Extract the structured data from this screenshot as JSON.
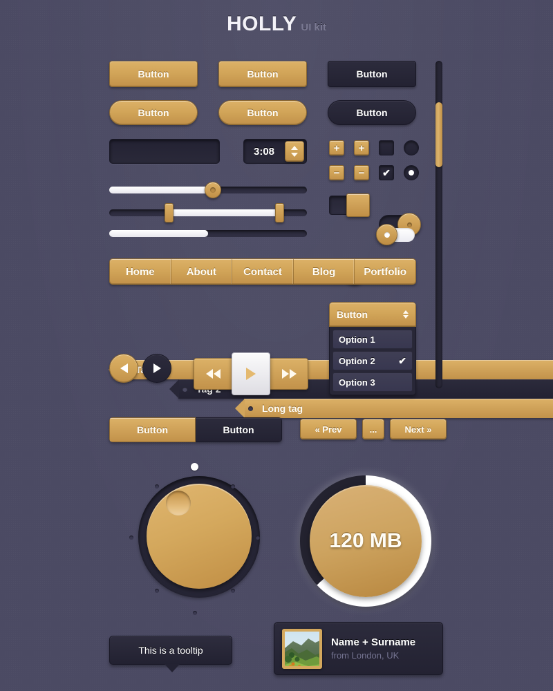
{
  "title": {
    "logo": "HOLLY",
    "subtitle": "UI kit"
  },
  "buttons": {
    "rect_gold_1": "Button",
    "rect_gold_2": "Button",
    "rect_dark": "Button",
    "pill_gold_1": "Button",
    "pill_gold_2": "Button",
    "pill_dark": "Button"
  },
  "search": {
    "value": "",
    "placeholder": "",
    "icon": "search-icon"
  },
  "stepper": {
    "value": "3:08",
    "up_icon": "triangle-up-icon",
    "down_icon": "triangle-down-icon"
  },
  "small_controls": {
    "plus_1": "+",
    "plus_2": "+",
    "minus_1": "−",
    "minus_2": "−",
    "checkbox_unchecked": "",
    "checkbox_checked": "✔",
    "radio_unselected": "",
    "radio_selected": "●"
  },
  "sliders": [
    {
      "name": "single-handle-slider",
      "fill_percent": 50,
      "handle_percent": 50
    },
    {
      "name": "range-slider",
      "start_percent": 30,
      "end_percent": 86
    },
    {
      "name": "progress-slider",
      "fill_percent": 50
    }
  ],
  "toggles": [
    {
      "name": "square-knob-toggle",
      "state": "on"
    },
    {
      "name": "pill-toggle-large",
      "state": "on"
    },
    {
      "name": "pill-toggle-small",
      "state": "on"
    },
    {
      "name": "pill-toggle-white",
      "state": "off"
    }
  ],
  "nav": {
    "items": [
      "Home",
      "About",
      "Contact",
      "Blog",
      "Portfolio"
    ]
  },
  "tags": [
    {
      "label": "Tag",
      "style": "gold"
    },
    {
      "label": "Tag 2",
      "style": "dark"
    },
    {
      "label": "Long tag",
      "style": "gold"
    }
  ],
  "dropdown": {
    "button_label": "Button",
    "options": [
      {
        "label": "Option 1",
        "selected": false
      },
      {
        "label": "Option 2",
        "selected": true
      },
      {
        "label": "Option 3",
        "selected": false
      }
    ],
    "check_glyph": "✔"
  },
  "media": {
    "prev_circle_icon": "triangle-left-icon",
    "next_circle_icon": "triangle-right-icon",
    "rewind_icon": "rewind-icon",
    "play_icon": "play-icon",
    "forward_icon": "fast-forward-icon"
  },
  "button_group": {
    "active": "Button",
    "inactive": "Button"
  },
  "pagination": {
    "prev": "« Prev",
    "ellipsis": "...",
    "next": "Next »"
  },
  "knob": {
    "name": "rotary-knob",
    "value_marker": "top-dot"
  },
  "progress": {
    "label": "120 MB",
    "percent": 63
  },
  "tooltip": {
    "text": "This is a tooltip"
  },
  "user_card": {
    "name": "Name + Surname",
    "location": "from London, UK",
    "avatar": "landscape-photo"
  },
  "scrollbar": {
    "thumb_top_percent": 13,
    "thumb_height_percent": 20
  },
  "colors": {
    "background": "#4b4a63",
    "gold": "#d2a55b",
    "gold_dark": "#c2924a",
    "dark_panel": "#272636",
    "text_light": "#fffdf6",
    "muted": "#747390"
  }
}
